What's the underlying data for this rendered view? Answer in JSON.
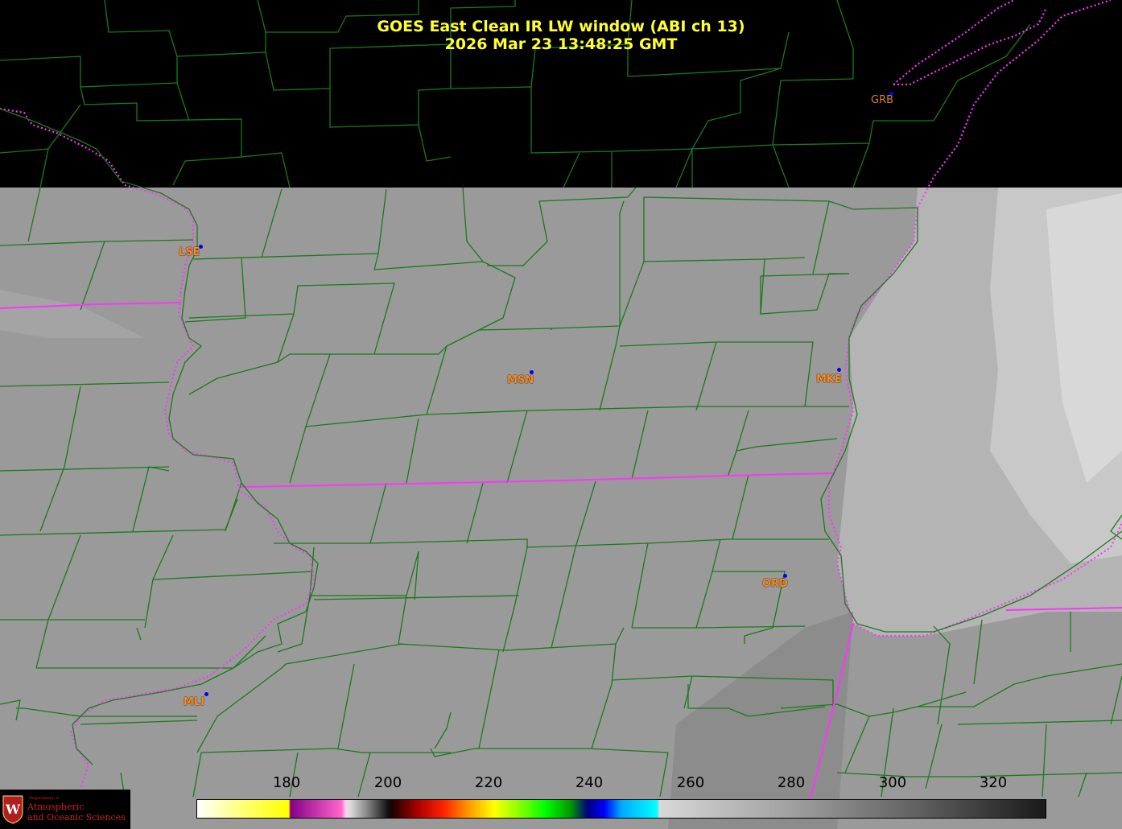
{
  "title_line1": "GOES East Clean IR LW window (ABI ch 13)",
  "title_line2": "2026 Mar 23  13:48:25 GMT",
  "stations": [
    {
      "id": "LSE",
      "label": "LSE"
    },
    {
      "id": "MSN",
      "label": "MSN"
    },
    {
      "id": "MKE",
      "label": "MKE"
    },
    {
      "id": "ORD",
      "label": "ORD"
    },
    {
      "id": "MLI",
      "label": "MLI"
    },
    {
      "id": "GRB",
      "label": "GRB"
    }
  ],
  "colorbar": {
    "ticks": [
      "180",
      "200",
      "220",
      "240",
      "260",
      "280",
      "300",
      "320"
    ]
  },
  "logo": {
    "dept": "Department of",
    "line1": "Atmospheric",
    "line2": "and Oceanic Sciences",
    "seal_letter": "W"
  },
  "colors": {
    "county_lines": "#1a7a1a",
    "state_lines": "#ff33ff",
    "title": "#ffff33",
    "station_label": "#ff8c1a",
    "station_dot": "#0000ff"
  }
}
